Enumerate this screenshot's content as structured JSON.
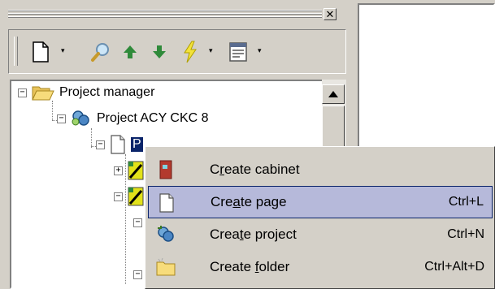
{
  "window": {
    "close_glyph": "✕"
  },
  "toolbar": {
    "buttons": [
      {
        "icon": "new-page-icon"
      },
      {
        "icon": "search-icon"
      },
      {
        "icon": "arrow-up-icon"
      },
      {
        "icon": "arrow-down-icon"
      },
      {
        "icon": "lightning-icon"
      },
      {
        "icon": "properties-icon"
      }
    ],
    "dropdown_glyph": "▾"
  },
  "tree": {
    "root": {
      "label": "Project manager",
      "expander": "−",
      "icon": "folder-open-icon"
    },
    "project": {
      "label": "Project ACY CKC 8",
      "expander": "−",
      "icon": "project-icon"
    },
    "selected_node": {
      "label": "P",
      "expander": "−",
      "icon": "page-icon"
    },
    "child_1": {
      "expander": "+",
      "icon": "cabinet-page-icon"
    },
    "child_2": {
      "expander": "−",
      "icon": "cabinet-page-icon"
    },
    "child_3": {
      "expander": "−"
    },
    "child_4": {
      "expander": "−"
    }
  },
  "context_menu": {
    "items": [
      {
        "pre": "C",
        "accel": "r",
        "post": "eate cabinet",
        "shortcut": "",
        "icon": "cabinet-icon",
        "highlighted": false
      },
      {
        "pre": "Cre",
        "accel": "a",
        "post": "te page",
        "shortcut": "Ctrl+L",
        "icon": "page-icon",
        "highlighted": true
      },
      {
        "pre": "Crea",
        "accel": "t",
        "post": "e project",
        "shortcut": "Ctrl+N",
        "icon": "project-icon",
        "highlighted": false
      },
      {
        "pre": "Create ",
        "accel": "f",
        "post": "older",
        "shortcut": "Ctrl+Alt+D",
        "icon": "folder-icon",
        "highlighted": false
      }
    ]
  },
  "colors": {
    "face": "#d4d0c8",
    "selection": "#0a246a",
    "menu_highlight": "#b6b9da"
  }
}
